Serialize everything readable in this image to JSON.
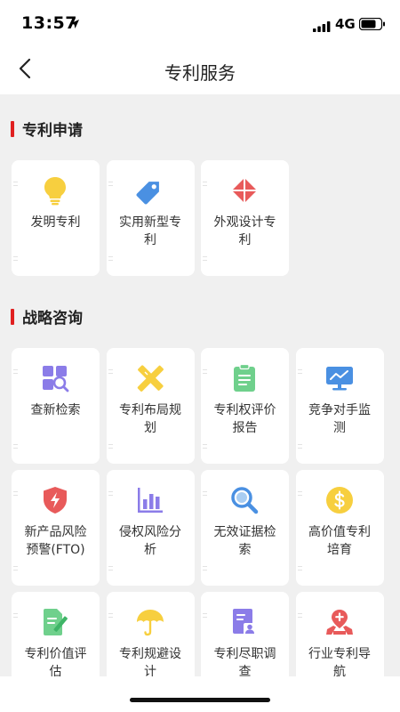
{
  "status_bar": {
    "time": "13:57",
    "network": "4G"
  },
  "nav": {
    "title": "专利服务"
  },
  "sections": [
    {
      "title": "专利申请",
      "items": [
        {
          "label": "发明专利",
          "icon": "lightbulb-icon"
        },
        {
          "label": "实用新型专利",
          "icon": "tag-icon"
        },
        {
          "label": "外观设计专利",
          "icon": "diamond-icon"
        }
      ]
    },
    {
      "title": "战略咨询",
      "items": [
        {
          "label": "查新检索",
          "icon": "search-grid-icon"
        },
        {
          "label": "专利布局规划",
          "icon": "pencil-ruler-icon"
        },
        {
          "label": "专利权评价报告",
          "icon": "clipboard-icon"
        },
        {
          "label": "竞争对手监测",
          "icon": "monitor-chart-icon"
        },
        {
          "label": "新产品风险预警(FTO)",
          "icon": "shield-bolt-icon"
        },
        {
          "label": "侵权风险分析",
          "icon": "bar-chart-icon"
        },
        {
          "label": "无效证据检索",
          "icon": "magnifier-icon"
        },
        {
          "label": "高价值专利培育",
          "icon": "dollar-coin-icon"
        },
        {
          "label": "专利价值评估",
          "icon": "document-edit-icon"
        },
        {
          "label": "专利规避设计",
          "icon": "umbrella-icon"
        },
        {
          "label": "专利尽职调查",
          "icon": "id-card-icon"
        },
        {
          "label": "行业专利导航",
          "icon": "map-pin-icon"
        }
      ]
    }
  ],
  "colors": {
    "accent": "#e02020",
    "yellow": "#f7cf3f",
    "blue": "#4a90e2",
    "red": "#e85a5a",
    "purple": "#8b7ce8",
    "green": "#6fd08c",
    "background": "#f0f0f0"
  }
}
